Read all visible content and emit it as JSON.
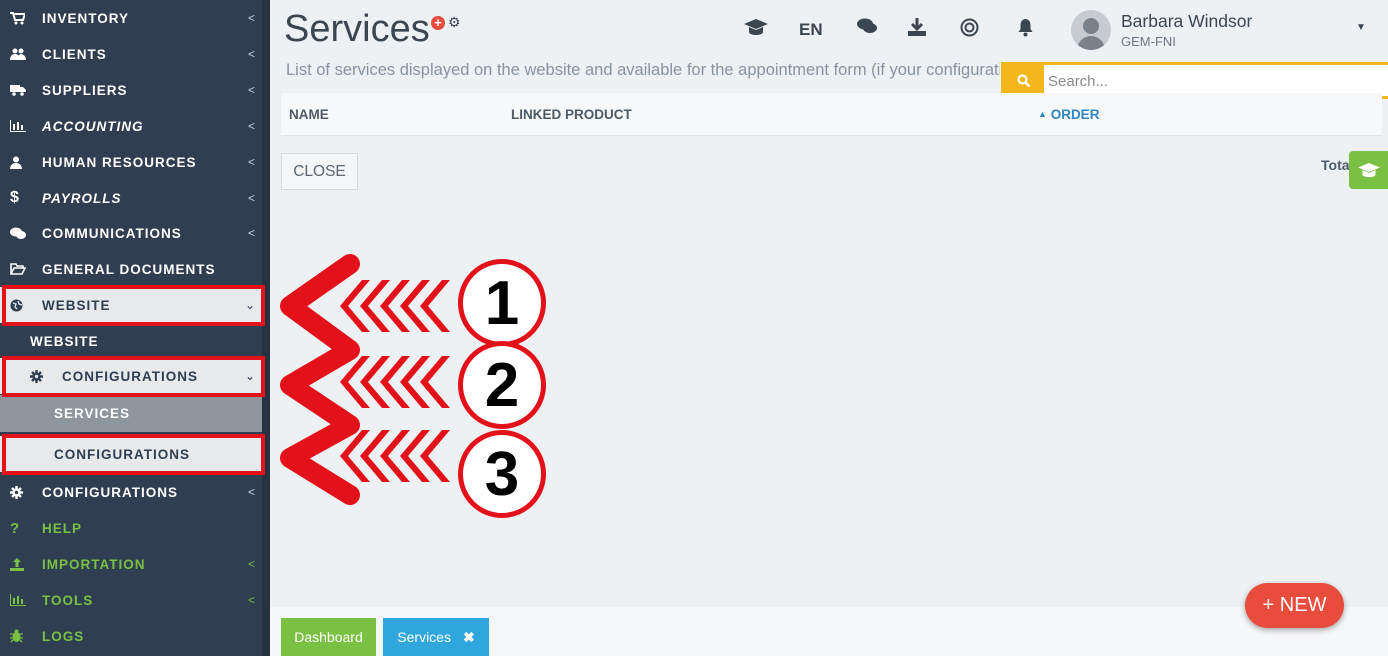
{
  "sidebar": {
    "items": [
      {
        "label": "INVENTORY",
        "icon": "cart-icon"
      },
      {
        "label": "CLIENTS",
        "icon": "users-icon"
      },
      {
        "label": "SUPPLIERS",
        "icon": "truck-icon"
      },
      {
        "label": "ACCOUNTING",
        "icon": "bar-chart-icon"
      },
      {
        "label": "HUMAN RESOURCES",
        "icon": "user-icon"
      },
      {
        "label": "PAYROLLS",
        "icon": "dollar-icon"
      },
      {
        "label": "COMMUNICATIONS",
        "icon": "comments-icon"
      },
      {
        "label": "GENERAL DOCUMENTS",
        "icon": "folder-open-icon"
      },
      {
        "label": "WEBSITE",
        "icon": "globe-icon"
      },
      {
        "label": "WEBSITE"
      },
      {
        "label": "CONFIGURATIONS",
        "icon": "gear-icon"
      },
      {
        "label": "SERVICES"
      },
      {
        "label": "CONFIGURATIONS"
      },
      {
        "label": "CONFIGURATIONS",
        "icon": "gear-icon"
      },
      {
        "label": "HELP",
        "icon": "question-icon"
      },
      {
        "label": "IMPORTATION",
        "icon": "upload-icon"
      },
      {
        "label": "TOOLS",
        "icon": "bar-chart-icon"
      },
      {
        "label": "LOGS",
        "icon": "bug-icon"
      }
    ]
  },
  "header": {
    "title": "Services",
    "subtitle": "List of services displayed on the website and available for the appointment form (if your configuration allows it).",
    "lang": "EN",
    "user_name": "Barbara Windsor",
    "user_company": "GEM-FNI"
  },
  "search": {
    "placeholder": "Search..."
  },
  "table": {
    "columns": [
      "NAME",
      "LINKED PRODUCT",
      "ORDER"
    ],
    "sorted_column": "ORDER"
  },
  "actions": {
    "close_label": "CLOSE",
    "total_label": "Total",
    "new_label": "+ NEW"
  },
  "annotations": {
    "badges": [
      "1",
      "2",
      "3"
    ]
  },
  "bottom_tabs": {
    "dashboard": "Dashboard",
    "services": "Services"
  },
  "colors": {
    "sidebar": "#2f3e50",
    "accent_red": "#e3111a",
    "green": "#7ac143",
    "blue": "#2fa7dd",
    "search_yellow": "#f3b71c"
  }
}
